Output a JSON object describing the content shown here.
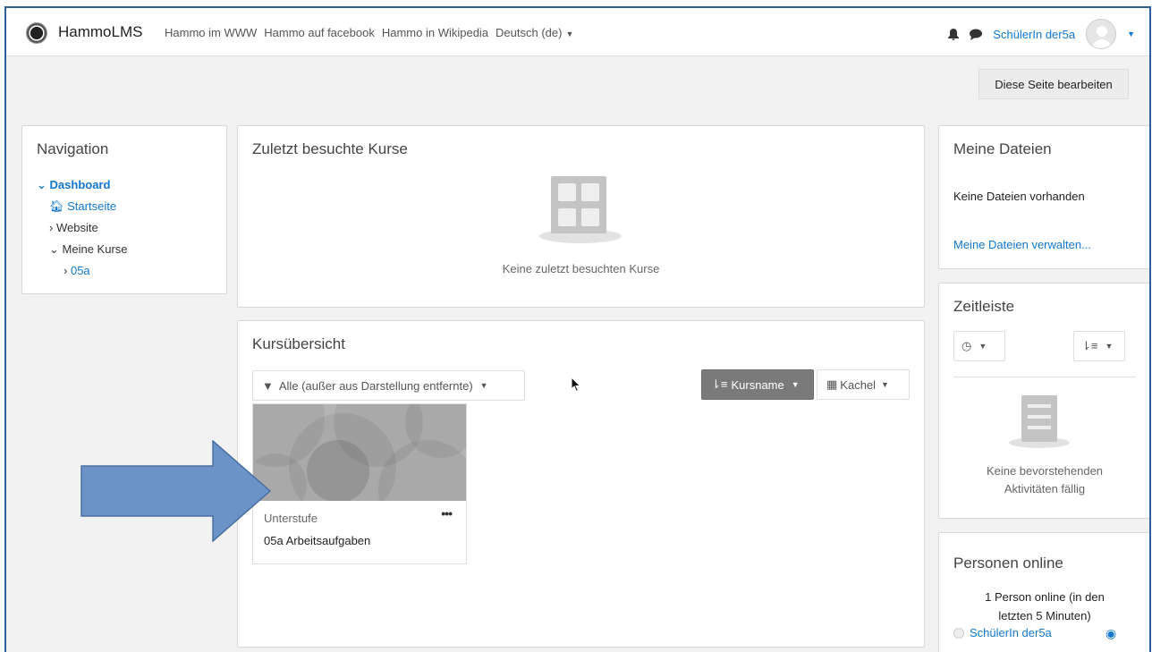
{
  "navbar": {
    "brand": "HammoLMS",
    "links": [
      "Hammo im WWW",
      "Hammo auf facebook",
      "Hammo in Wikipedia",
      "Deutsch (de)"
    ],
    "user_name": "SchülerIn der5a"
  },
  "page": {
    "edit_button": "Diese Seite bearbeiten"
  },
  "navigation": {
    "title": "Navigation",
    "dashboard": "Dashboard",
    "home": "Startseite",
    "website": "Website",
    "my_courses": "Meine Kurse",
    "course": "05a"
  },
  "recent": {
    "title": "Zuletzt besuchte Kurse",
    "empty": "Keine zuletzt besuchten Kurse"
  },
  "overview": {
    "title": "Kursübersicht",
    "filter": "Alle (außer aus Darstellung entfernte)",
    "sort": "Kursname",
    "view": "Kachel",
    "course_category": "Unterstufe",
    "course_name": "05a Arbeitsaufgaben",
    "course_menu": "•••"
  },
  "files": {
    "title": "Meine Dateien",
    "empty": "Keine Dateien vorhanden",
    "manage": "Meine Dateien verwalten..."
  },
  "timeline": {
    "title": "Zeitleiste",
    "empty_line1": "Keine bevorstehenden",
    "empty_line2": "Aktivitäten fällig"
  },
  "online": {
    "title": "Personen online",
    "line1": "1 Person online (in den",
    "line2": "letzten 5 Minuten)",
    "user": "SchülerIn der5a"
  },
  "colors": {
    "link": "#1177d1",
    "arrow": "#6b93c8",
    "frame": "#2e5d99"
  }
}
